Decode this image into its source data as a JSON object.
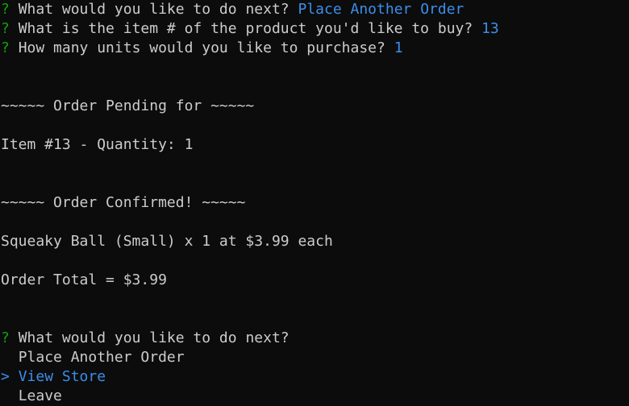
{
  "colors": {
    "background": "#0c0c0c",
    "text": "#cccccc",
    "prompt_marker": "#13a10e",
    "answer": "#3b8eea"
  },
  "prompts": [
    {
      "marker": "?",
      "question": "What would you like to do next?",
      "answer": "Place Another Order"
    },
    {
      "marker": "?",
      "question": "What is the item # of the product you'd like to buy?",
      "answer": "13"
    },
    {
      "marker": "?",
      "question": "How many units would you like to purchase?",
      "answer": "1"
    }
  ],
  "pending": {
    "header": "~~~~~ Order Pending for ~~~~~",
    "detail": "Item #13 - Quantity: 1"
  },
  "confirmed": {
    "header": "~~~~~ Order Confirmed! ~~~~~",
    "detail": "Squeaky Ball (Small) x 1 at $3.99 each",
    "total": "Order Total = $3.99"
  },
  "menu": {
    "marker": "?",
    "question": "What would you like to do next?",
    "pointer": ">",
    "options": [
      "Place Another Order",
      "View Store",
      "Leave"
    ],
    "selected_index": 1
  }
}
